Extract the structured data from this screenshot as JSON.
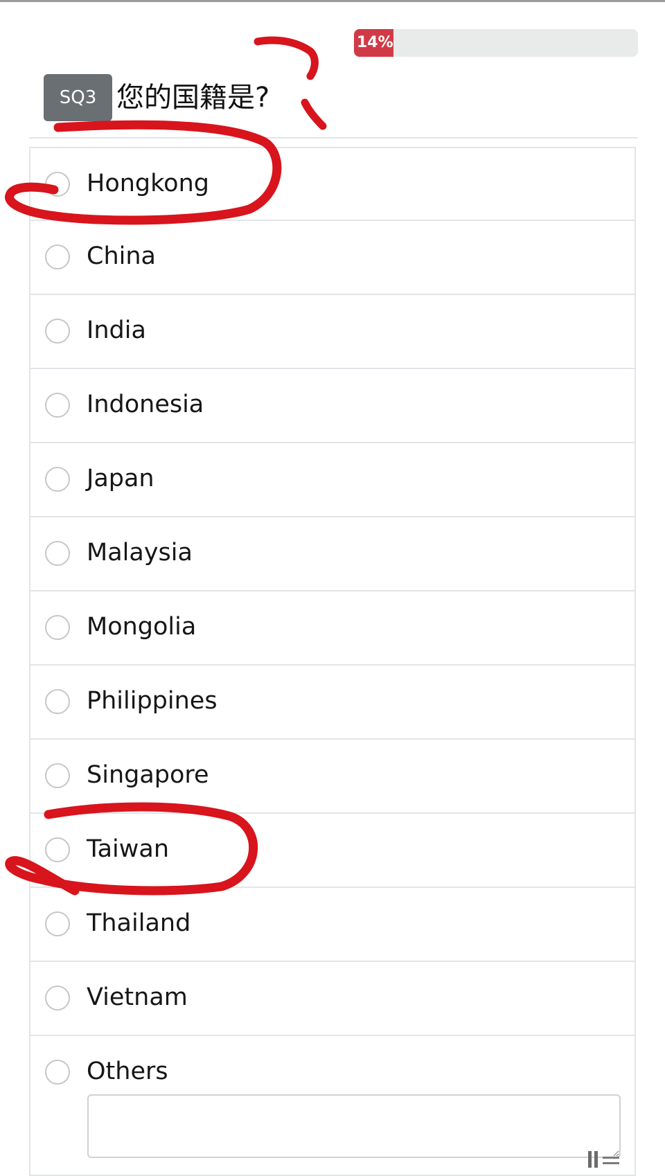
{
  "progress": {
    "value_percent": 14,
    "label": "14%",
    "fill_color": "#d03a46"
  },
  "question": {
    "badge": "SQ3",
    "text": "您的国籍是?"
  },
  "options": [
    {
      "label": "Hongkong"
    },
    {
      "label": "China"
    },
    {
      "label": "India"
    },
    {
      "label": "Indonesia"
    },
    {
      "label": "Japan"
    },
    {
      "label": "Malaysia"
    },
    {
      "label": "Mongolia"
    },
    {
      "label": "Philippines"
    },
    {
      "label": "Singapore"
    },
    {
      "label": "Taiwan"
    },
    {
      "label": "Thailand"
    },
    {
      "label": "Vietnam"
    },
    {
      "label": "Others"
    }
  ],
  "others_input": {
    "value": "",
    "placeholder": ""
  },
  "annotation": {
    "color": "#d8141c",
    "circled_options": [
      "Hongkong",
      "Taiwan"
    ]
  }
}
